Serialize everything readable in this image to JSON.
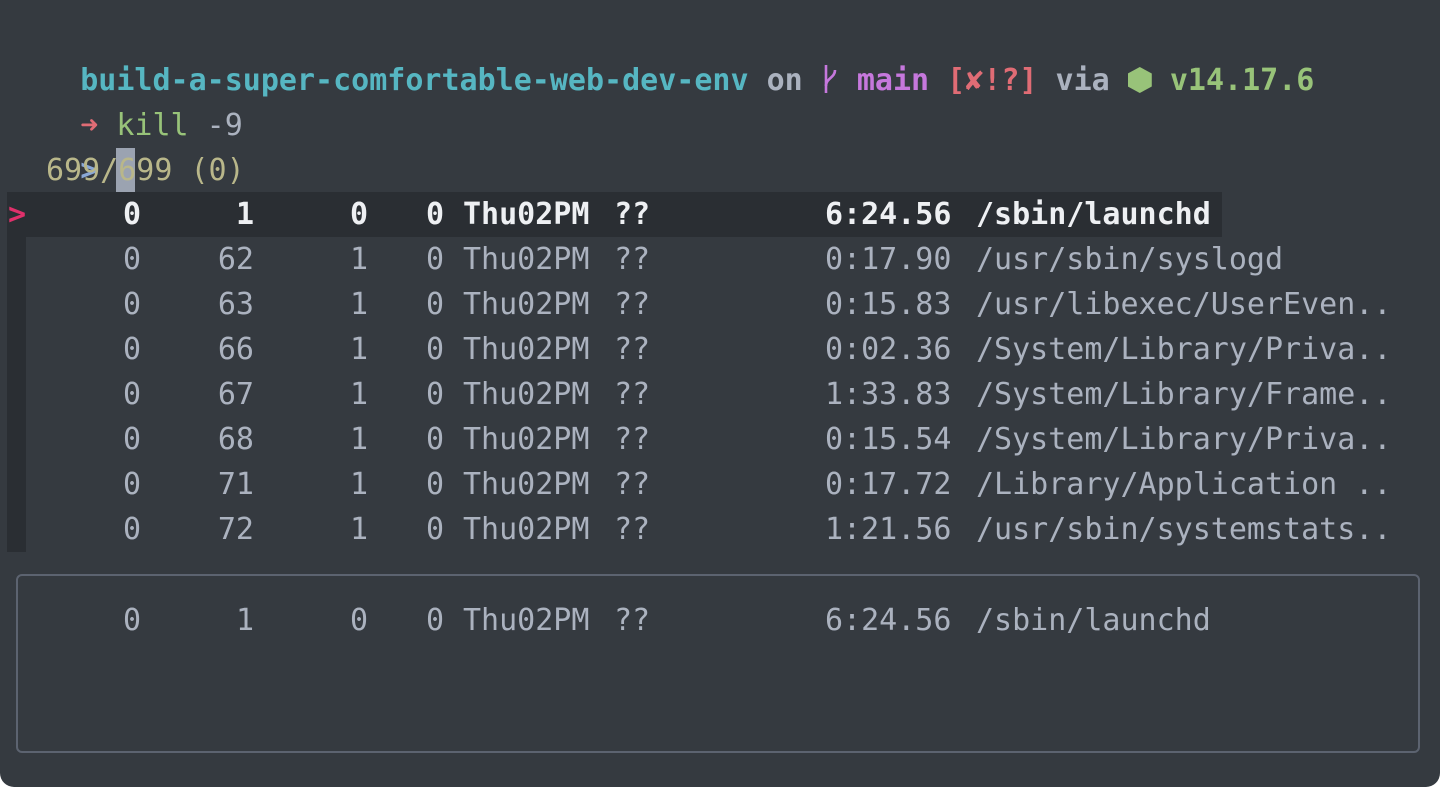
{
  "prompt": {
    "directory": "build-a-super-comfortable-web-dev-env",
    "on_text": "on",
    "branch_icon": "git-branch-icon",
    "branch": "main",
    "git_status": "[✘!?]",
    "via_text": "via",
    "node_icon": "nodejs-hexagon-icon",
    "node_version": "v14.17.6"
  },
  "command": {
    "arrow": "➜",
    "keyword": "kill",
    "args": " -9"
  },
  "fzf": {
    "prompt_symbol": ">",
    "query": "",
    "count": "699/699 (0)",
    "pointer": ">",
    "rows": [
      {
        "uid": "0",
        "pid": "1",
        "ppid": "0",
        "c": "0",
        "stime": "Thu02PM",
        "tty": "??",
        "time": "6:24.56",
        "cmd": "/sbin/launchd"
      },
      {
        "uid": "0",
        "pid": "62",
        "ppid": "1",
        "c": "0",
        "stime": "Thu02PM",
        "tty": "??",
        "time": "0:17.90",
        "cmd": "/usr/sbin/syslogd"
      },
      {
        "uid": "0",
        "pid": "63",
        "ppid": "1",
        "c": "0",
        "stime": "Thu02PM",
        "tty": "??",
        "time": "0:15.83",
        "cmd": "/usr/libexec/UserEven.."
      },
      {
        "uid": "0",
        "pid": "66",
        "ppid": "1",
        "c": "0",
        "stime": "Thu02PM",
        "tty": "??",
        "time": "0:02.36",
        "cmd": "/System/Library/Priva.."
      },
      {
        "uid": "0",
        "pid": "67",
        "ppid": "1",
        "c": "0",
        "stime": "Thu02PM",
        "tty": "??",
        "time": "1:33.83",
        "cmd": "/System/Library/Frame.."
      },
      {
        "uid": "0",
        "pid": "68",
        "ppid": "1",
        "c": "0",
        "stime": "Thu02PM",
        "tty": "??",
        "time": "0:15.54",
        "cmd": "/System/Library/Priva.."
      },
      {
        "uid": "0",
        "pid": "71",
        "ppid": "1",
        "c": "0",
        "stime": "Thu02PM",
        "tty": "??",
        "time": "0:17.72",
        "cmd": "/Library/Application .."
      },
      {
        "uid": "0",
        "pid": "72",
        "ppid": "1",
        "c": "0",
        "stime": "Thu02PM",
        "tty": "??",
        "time": "1:21.56",
        "cmd": "/usr/sbin/systemstats.."
      }
    ],
    "preview": {
      "uid": "0",
      "pid": "1",
      "ppid": "0",
      "c": "0",
      "stime": "Thu02PM",
      "tty": "??",
      "time": "6:24.56",
      "cmd": "/sbin/launchd"
    }
  },
  "colors": {
    "background": "#353a40",
    "selection": "#2a2e33",
    "directory": "#56b6c2",
    "branch": "#c678dd",
    "git_status": "#e06c75",
    "node": "#98c379",
    "pointer": "#e0306b"
  }
}
